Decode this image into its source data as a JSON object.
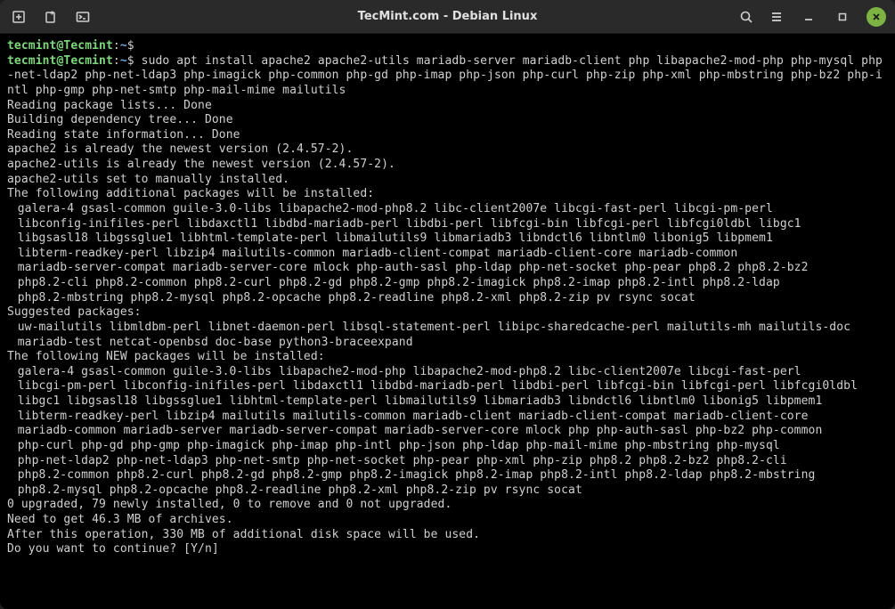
{
  "titlebar": {
    "title": "TecMint.com - Debian Linux"
  },
  "prompt": {
    "user_host": "tecmint@Tecmint",
    "sep": ":",
    "path": "~",
    "symbol": "$"
  },
  "command": "sudo apt install apache2 apache2-utils mariadb-server mariadb-client php libapache2-mod-php php-mysql php-net-ldap2 php-net-ldap3 php-imagick php-common php-gd php-imap php-json php-curl php-zip php-xml php-mbstring php-bz2 php-intl php-gmp php-net-smtp php-mail-mime mailutils",
  "output": {
    "l1": "Reading package lists... Done",
    "l2": "Building dependency tree... Done",
    "l3": "Reading state information... Done",
    "l4": "apache2 is already the newest version (2.4.57-2).",
    "l5": "apache2-utils is already the newest version (2.4.57-2).",
    "l6": "apache2-utils set to manually installed.",
    "l7": "The following additional packages will be installed:",
    "l8": "galera-4 gsasl-common guile-3.0-libs libapache2-mod-php8.2 libc-client2007e libcgi-fast-perl libcgi-pm-perl",
    "l9": "libconfig-inifiles-perl libdaxctl1 libdbd-mariadb-perl libdbi-perl libfcgi-bin libfcgi-perl libfcgi0ldbl libgc1",
    "l10": "libgsasl18 libgssglue1 libhtml-template-perl libmailutils9 libmariadb3 libndctl6 libntlm0 libonig5 libpmem1",
    "l11": "libterm-readkey-perl libzip4 mailutils-common mariadb-client-compat mariadb-client-core mariadb-common",
    "l12": "mariadb-server-compat mariadb-server-core mlock php-auth-sasl php-ldap php-net-socket php-pear php8.2 php8.2-bz2",
    "l13": "php8.2-cli php8.2-common php8.2-curl php8.2-gd php8.2-gmp php8.2-imagick php8.2-imap php8.2-intl php8.2-ldap",
    "l14": "php8.2-mbstring php8.2-mysql php8.2-opcache php8.2-readline php8.2-xml php8.2-zip pv rsync socat",
    "l15": "Suggested packages:",
    "l16": "uw-mailutils libmldbm-perl libnet-daemon-perl libsql-statement-perl libipc-sharedcache-perl mailutils-mh mailutils-doc",
    "l17": "mariadb-test netcat-openbsd doc-base python3-braceexpand",
    "l18": "The following NEW packages will be installed:",
    "l19": "galera-4 gsasl-common guile-3.0-libs libapache2-mod-php libapache2-mod-php8.2 libc-client2007e libcgi-fast-perl",
    "l20": "libcgi-pm-perl libconfig-inifiles-perl libdaxctl1 libdbd-mariadb-perl libdbi-perl libfcgi-bin libfcgi-perl libfcgi0ldbl",
    "l21": "libgc1 libgsasl18 libgssglue1 libhtml-template-perl libmailutils9 libmariadb3 libndctl6 libntlm0 libonig5 libpmem1",
    "l22": "libterm-readkey-perl libzip4 mailutils mailutils-common mariadb-client mariadb-client-compat mariadb-client-core",
    "l23": "mariadb-common mariadb-server mariadb-server-compat mariadb-server-core mlock php php-auth-sasl php-bz2 php-common",
    "l24": "php-curl php-gd php-gmp php-imagick php-imap php-intl php-json php-ldap php-mail-mime php-mbstring php-mysql",
    "l25": "php-net-ldap2 php-net-ldap3 php-net-smtp php-net-socket php-pear php-xml php-zip php8.2 php8.2-bz2 php8.2-cli",
    "l26": "php8.2-common php8.2-curl php8.2-gd php8.2-gmp php8.2-imagick php8.2-imap php8.2-intl php8.2-ldap php8.2-mbstring",
    "l27": "php8.2-mysql php8.2-opcache php8.2-readline php8.2-xml php8.2-zip pv rsync socat",
    "l28": "0 upgraded, 79 newly installed, 0 to remove and 0 not upgraded.",
    "l29": "Need to get 46.3 MB of archives.",
    "l30": "After this operation, 330 MB of additional disk space will be used.",
    "l31": "Do you want to continue? [Y/n]"
  }
}
